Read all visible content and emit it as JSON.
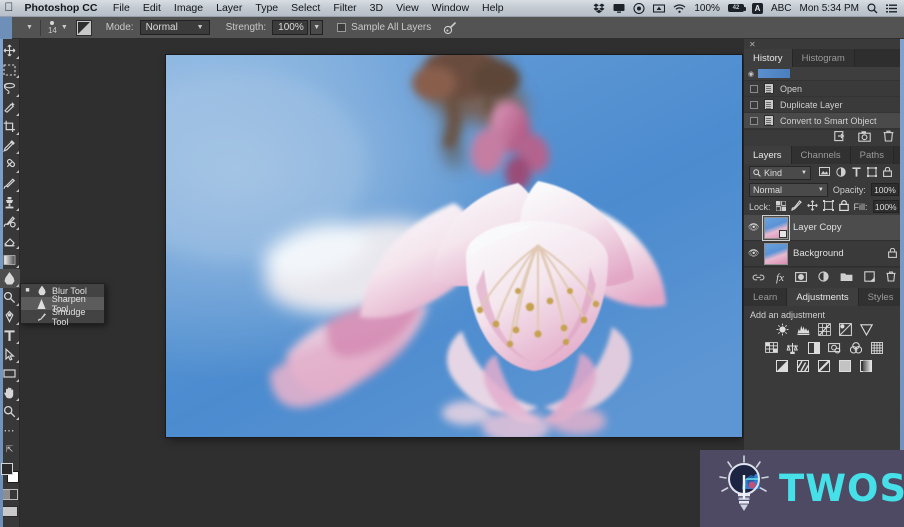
{
  "menubar": {
    "apple_icon": "apple-logo",
    "app_name": "Photoshop CC",
    "items": [
      "File",
      "Edit",
      "Image",
      "Layer",
      "Type",
      "Select",
      "Filter",
      "3D",
      "View",
      "Window",
      "Help"
    ],
    "status": {
      "dropbox_icon": "dropbox-icon",
      "display_icon": "display-icon",
      "airplay_icon": "airplay-icon",
      "bluetooth_icon": "bluetooth-icon",
      "wifi_icon": "wifi-icon",
      "battery_percent": "100%",
      "battery_icon_label": "42",
      "input_flag": "A",
      "input_source": "ABC",
      "clock": "Mon 5:34 PM",
      "search_icon": "search-icon",
      "notification_icon": "notification-center-icon"
    }
  },
  "options_bar": {
    "tool_icon": "blur-tool-icon",
    "brush_size": "14",
    "brush_preset_icon": "brush-preset-icon",
    "mode_label": "Mode:",
    "mode_value": "Normal",
    "strength_label": "Strength:",
    "strength_value": "100%",
    "sample_all_layers_label": "Sample All Layers",
    "sample_all_layers_checked": false,
    "airbrush_icon": "airbrush-icon"
  },
  "toolbar": {
    "tools": [
      {
        "name": "move-tool",
        "glyph": "move"
      },
      {
        "name": "marquee-tool",
        "glyph": "marquee"
      },
      {
        "name": "lasso-tool",
        "glyph": "lasso"
      },
      {
        "name": "quick-selection-tool",
        "glyph": "quickselect"
      },
      {
        "name": "crop-tool",
        "glyph": "crop"
      },
      {
        "name": "eyedropper-tool",
        "glyph": "eyedropper"
      },
      {
        "name": "healing-brush-tool",
        "glyph": "heal"
      },
      {
        "name": "brush-tool",
        "glyph": "brush"
      },
      {
        "name": "clone-stamp-tool",
        "glyph": "stamp"
      },
      {
        "name": "history-brush-tool",
        "glyph": "historybrush"
      },
      {
        "name": "eraser-tool",
        "glyph": "eraser"
      },
      {
        "name": "gradient-tool",
        "glyph": "gradient"
      },
      {
        "name": "blur-tool",
        "glyph": "blur"
      },
      {
        "name": "dodge-tool",
        "glyph": "dodge"
      },
      {
        "name": "pen-tool",
        "glyph": "pen"
      },
      {
        "name": "type-tool",
        "glyph": "type"
      },
      {
        "name": "path-selection-tool",
        "glyph": "pathselect"
      },
      {
        "name": "rectangle-tool",
        "glyph": "rectangle"
      },
      {
        "name": "hand-tool",
        "glyph": "hand"
      },
      {
        "name": "zoom-tool",
        "glyph": "zoom"
      },
      {
        "name": "edit-toolbar",
        "glyph": "ellipsis"
      },
      {
        "name": "default-colors",
        "glyph": "defaultcolors"
      }
    ]
  },
  "tool_flyout": {
    "items": [
      {
        "label": "Blur Tool",
        "icon": "blur-tool-icon",
        "selected": false,
        "marked": true
      },
      {
        "label": "Sharpen Tool",
        "icon": "sharpen-tool-icon",
        "selected": true,
        "marked": false
      },
      {
        "label": "Smudge Tool",
        "icon": "smudge-tool-icon",
        "selected": false,
        "marked": false
      }
    ]
  },
  "history_panel": {
    "close_icon": "close-icon",
    "tabs": [
      {
        "label": "History",
        "active": true
      },
      {
        "label": "Histogram",
        "active": false
      }
    ],
    "snapshot_label": "",
    "items": [
      {
        "label": "Open",
        "current": false
      },
      {
        "label": "Duplicate Layer",
        "current": false
      },
      {
        "label": "Convert to Smart Object",
        "current": true
      }
    ],
    "footer_icons": [
      "create-document-from-state-icon",
      "create-snapshot-icon",
      "delete-state-icon"
    ]
  },
  "layers_panel": {
    "tabs": [
      {
        "label": "Layers",
        "active": true
      },
      {
        "label": "Channels",
        "active": false
      },
      {
        "label": "Paths",
        "active": false
      }
    ],
    "filter_kind": "Kind",
    "filter_icons": [
      "pixel-filter-icon",
      "adjustment-filter-icon",
      "type-filter-icon",
      "shape-filter-icon",
      "smart-object-filter-icon"
    ],
    "blend_mode": "Normal",
    "opacity_label": "Opacity:",
    "opacity_value": "100%",
    "lock_label": "Lock:",
    "lock_icons": [
      "lock-transparent-pixels-icon",
      "lock-image-pixels-icon",
      "lock-position-icon",
      "lock-artboard-icon",
      "lock-all-icon"
    ],
    "fill_label": "Fill:",
    "fill_value": "100%",
    "layers": [
      {
        "name": "Layer Copy",
        "visible": true,
        "selected": true,
        "smart_object": true,
        "locked": false
      },
      {
        "name": "Background",
        "visible": true,
        "selected": false,
        "smart_object": false,
        "locked": true
      }
    ],
    "footer_icons": [
      "link-layers-icon",
      "layer-style-fx-icon",
      "add-layer-mask-icon",
      "new-adjustment-layer-icon",
      "new-group-icon",
      "new-layer-icon",
      "delete-layer-icon"
    ]
  },
  "adjustments_panel": {
    "tabs": [
      {
        "label": "Learn",
        "active": false
      },
      {
        "label": "Adjustments",
        "active": true
      },
      {
        "label": "Styles",
        "active": false
      }
    ],
    "title": "Add an adjustment",
    "rows": [
      [
        "brightness-contrast-icon",
        "levels-icon",
        "curves-icon",
        "exposure-icon",
        "vibrance-icon"
      ],
      [
        "hue-saturation-icon",
        "color-balance-icon",
        "black-white-icon",
        "photo-filter-icon",
        "channel-mixer-icon",
        "color-lookup-icon"
      ],
      [
        "invert-icon",
        "posterize-icon",
        "threshold-icon",
        "gradient-map-icon",
        "selective-color-icon"
      ]
    ]
  },
  "document": {
    "subject": "cherry-blossom-photo",
    "colors": {
      "sky_top": "#6ea4da",
      "sky_mid": "#4f8fd0",
      "sky_bottom": "#5e98d6",
      "petal_light": "#fdf2f5",
      "petal_pink": "#e89ec0",
      "petal_deep": "#c65f92",
      "stamen": "#caa24a",
      "stem": "#6a5340"
    }
  },
  "watermark": {
    "text": "TWOS",
    "icon": "lightbulb-icon",
    "bg_color": "#4f4a63",
    "text_color": "#45e0e8"
  }
}
